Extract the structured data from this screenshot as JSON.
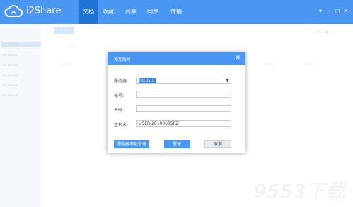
{
  "app": {
    "name": "i2Share",
    "brand_color": "#4a97f3"
  },
  "nav": {
    "items": [
      {
        "label": "文档",
        "active": true
      },
      {
        "label": "收藏",
        "active": false
      },
      {
        "label": "共享",
        "active": false
      },
      {
        "label": "同步",
        "active": false
      },
      {
        "label": "传输",
        "active": false
      }
    ]
  },
  "window_controls": {
    "menu": "▾",
    "minimize": "–",
    "maximize": "□",
    "close": "✕"
  },
  "dialog": {
    "title": "添加账号",
    "close": "✕",
    "fields": {
      "server": {
        "label": "服务器:",
        "value": "https://"
      },
      "account": {
        "label": "账号:",
        "value": ""
      },
      "password": {
        "label": "密码:",
        "value": ""
      },
      "hostname": {
        "label": "主机名:",
        "value": "USER-20190605RZ"
      }
    },
    "buttons": {
      "server_manage": "服务器地址管理",
      "login": "登录",
      "cancel": "取消"
    }
  },
  "watermark": "9553下载"
}
